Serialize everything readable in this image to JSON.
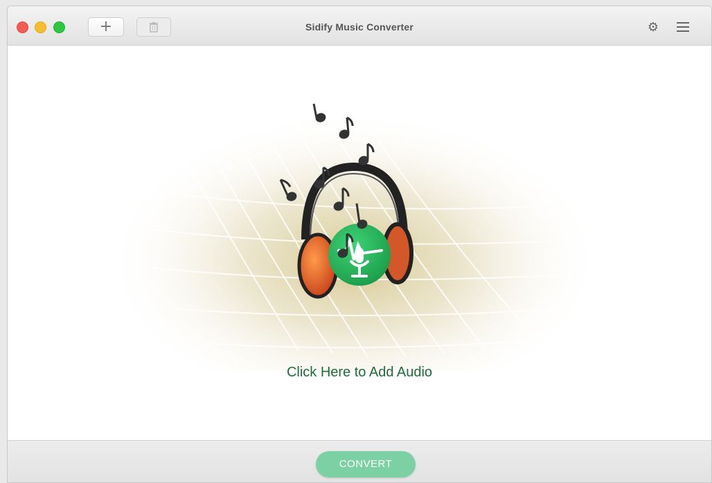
{
  "window": {
    "title": "Sidify Music Converter",
    "add_label": "+",
    "delete_icon": "trash-icon",
    "settings_icon": "gear-icon",
    "menu_icon": "hamburger-menu-icon"
  },
  "main": {
    "illustration_icon": "headphones-icon",
    "add_audio_text": "Click Here to Add Audio"
  },
  "footer": {
    "convert_label": "CONVERT"
  },
  "colors": {
    "accent": "#27b35c",
    "convert_button": "#7bd1a3",
    "add_audio_text": "#1f6b3a"
  }
}
